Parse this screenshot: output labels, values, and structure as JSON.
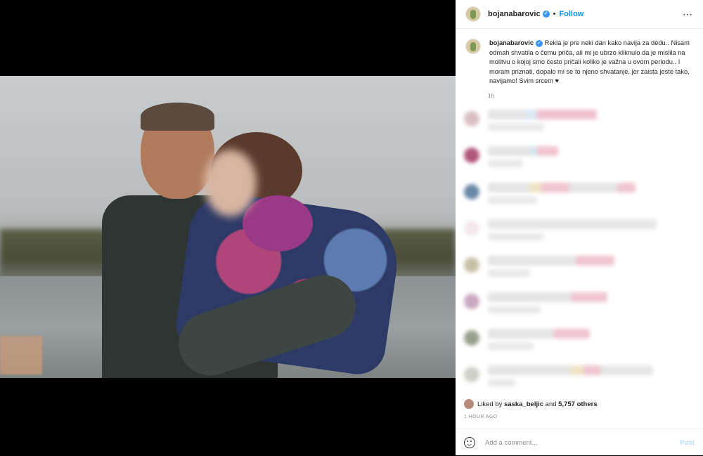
{
  "header": {
    "username": "bojanabarovic",
    "separator": "•",
    "follow_label": "Follow",
    "more_icon": "⋯"
  },
  "caption": {
    "username": "bojanabarovic",
    "text": "Rekla je pre neki dan kako navija za dedu.. Nisam odmah shvatila o čemu priča, ali mi je ubrzo kliknulo da je mislila na molitvu o kojoj smo često pričali koliko je važna u ovom periodu.. I moram priznati, dopalo mi se to njeno shvatanje, jer zaista jeste tako, navijamo! Svim srcem ♥",
    "time": "1h"
  },
  "colors": {
    "accent": "#0095f6",
    "verified": "#3897f0"
  },
  "likes": {
    "prefix": "Liked by",
    "user": "saska_beljic",
    "mid": "and",
    "count": "5,757 others"
  },
  "posted": "1 HOUR AGO",
  "add_comment": {
    "placeholder": "Add a comment...",
    "post_label": "Post"
  }
}
